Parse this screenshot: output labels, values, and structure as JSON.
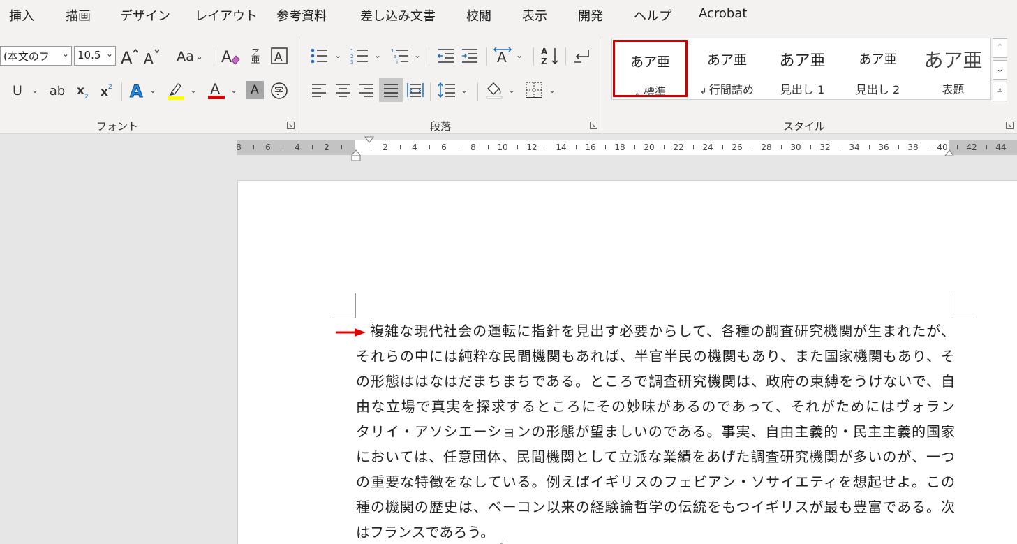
{
  "menu_tabs": [
    "挿入",
    "描画",
    "デザイン",
    "レイアウト",
    "参考資料",
    "差し込み文書",
    "校閲",
    "表示",
    "開発",
    "ヘルプ",
    "Acrobat"
  ],
  "font_group": {
    "font_name": "(本文のフ",
    "font_size": "10.5",
    "label": "フォント",
    "ruby_top": "ア",
    "ruby_bottom": "亜",
    "change_case": "Aa",
    "highlight_color": "#ffff00",
    "font_color": "#e00000"
  },
  "paragraph_group": {
    "label": "段落"
  },
  "styles_group": {
    "label": "スタイル",
    "items": [
      {
        "sample": "あア亜",
        "name": "標準",
        "selected": true
      },
      {
        "sample": "あア亜",
        "name": "行間詰め"
      },
      {
        "sample": "あア亜",
        "name": "見出し 1"
      },
      {
        "sample": "あア亜",
        "name": "見出し 2"
      },
      {
        "sample": "あア亜",
        "name": "表題"
      }
    ]
  },
  "ruler": {
    "left_numbers": [
      "8",
      "6",
      "4",
      "2"
    ],
    "right_numbers": [
      "2",
      "4",
      "6",
      "8",
      "10",
      "12",
      "14",
      "16",
      "18",
      "20",
      "22",
      "24",
      "26",
      "28",
      "30",
      "32",
      "34",
      "36",
      "38",
      "40",
      "42",
      "44"
    ]
  },
  "document": {
    "lines": [
      "複雑な現代社会の運転に指針を見出す必要からして、各種の調査研究機関が生まれたが、",
      "それらの中には純粋な民間機関もあれば、半官半民の機関もあり、また国家機関もあり、そ",
      "の形態ははなはだまちまちである。ところで調査研究機関は、政府の束縛をうけないで、自",
      "由な立場で真実を探求するところにその妙味があるのであって、それがためにはヴォラン",
      "タリイ・アソシエーションの形態が望ましいのである。事実、自由主義的・民主主義的国家",
      "においては、任意団体、民間機関として立派な業績をあげた調査研究機関が多いのが、一つ",
      "の重要な特徴をなしている。例えばイギリスのフェビアン・ソサイエティを想起せよ。この",
      "種の機関の歴史は、ベーコン以来の経験論哲学の伝統をもつイギリスが最も豊富である。次",
      "はフランスであろう。"
    ],
    "annotation_color": "#e00000"
  }
}
